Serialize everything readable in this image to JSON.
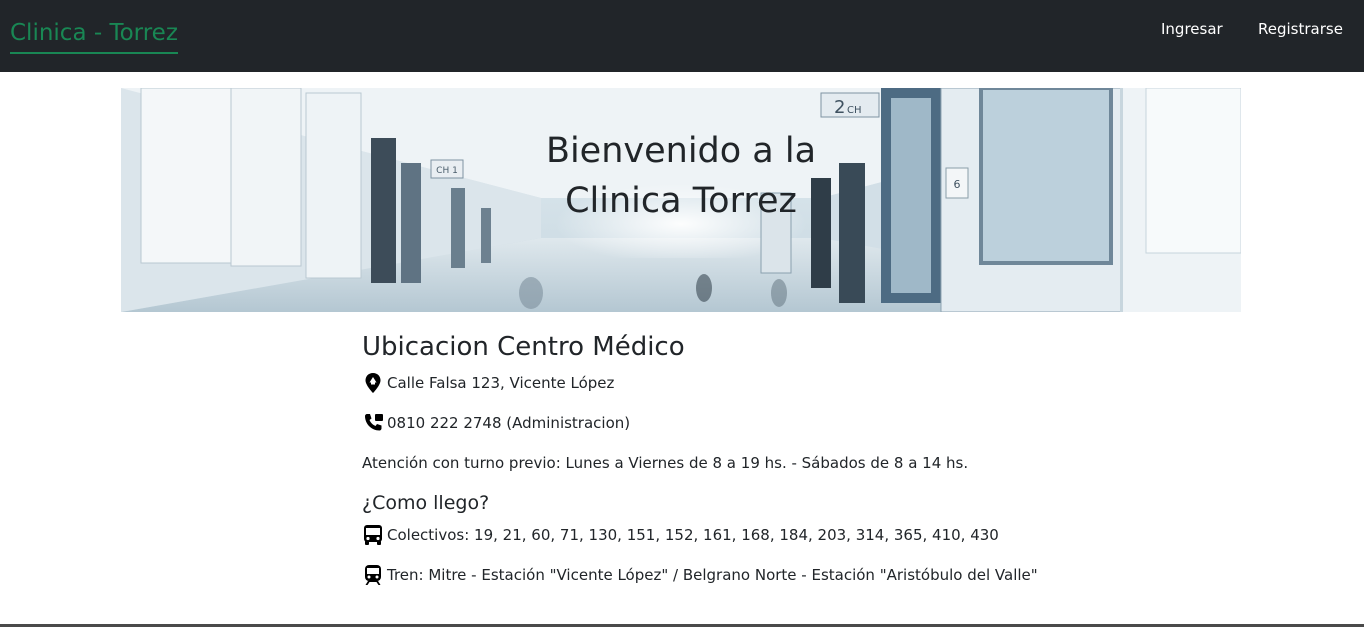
{
  "navbar": {
    "brand": "Clinica - Torrez",
    "links": {
      "login": "Ingresar",
      "register": "Registrarse"
    }
  },
  "hero": {
    "title_line1": "Bienvenido a la",
    "title_line2": "Clinica Torrez",
    "signs": {
      "sign_left": "CH 1",
      "sign_right_num": "2",
      "sign_right_ch": "CH",
      "sign_door": "6"
    }
  },
  "location": {
    "title": "Ubicacion Centro Médico",
    "address": "Calle Falsa 123, Vicente López",
    "phone": "0810 222 2748 (Administracion)",
    "hours": "Atención con turno previo: Lunes a Viernes de 8 a 19 hs. - Sábados de 8 a 14 hs."
  },
  "directions": {
    "title": "¿Como llego?",
    "bus": "Colectivos: 19, 21, 60, 71, 130, 151, 152, 161, 168, 184, 203, 314, 365, 410, 430",
    "train": "Tren: Mitre - Estación \"Vicente López\" / Belgrano Norte - Estación \"Aristóbulo del Valle\""
  },
  "colors": {
    "navbar_bg": "#212529",
    "brand": "#198754",
    "text": "#212529"
  },
  "icons": {
    "address": "map-pin-icon",
    "phone": "phone-icon",
    "bus": "bus-icon",
    "train": "train-icon"
  }
}
